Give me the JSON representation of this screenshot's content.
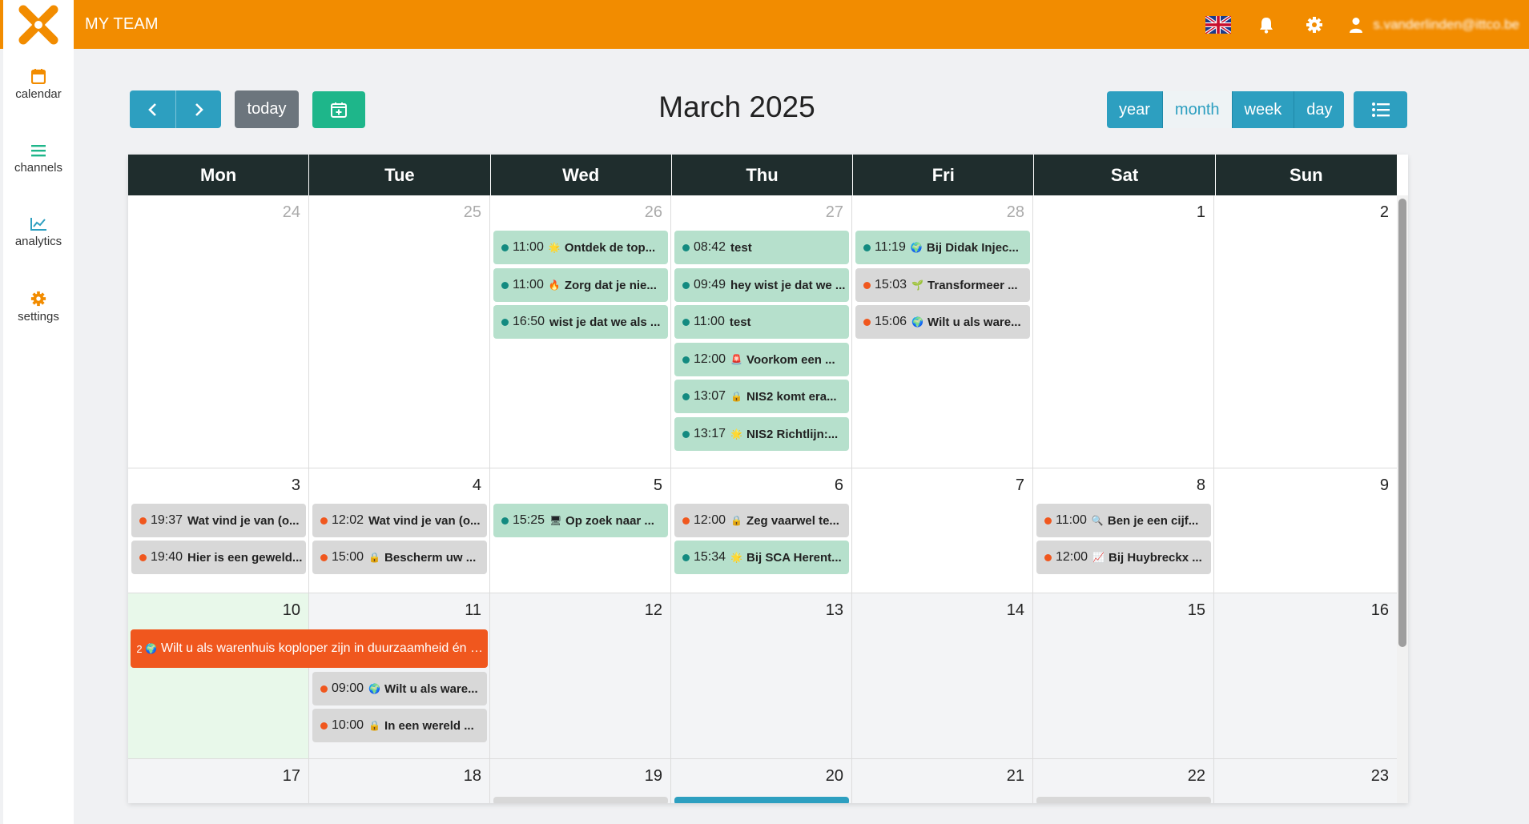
{
  "app": {
    "title": "MY TEAM",
    "user_email": "s.vanderlinden@ittco.be"
  },
  "sidebar": {
    "items": [
      {
        "label": "calendar",
        "icon": "calendar-icon",
        "color": "#f28c00"
      },
      {
        "label": "channels",
        "icon": "menu-icon",
        "color": "#1eb68a"
      },
      {
        "label": "analytics",
        "icon": "chart-line-icon",
        "color": "#2d9fc0"
      },
      {
        "label": "settings",
        "icon": "gear-icon",
        "color": "#f28c00"
      }
    ]
  },
  "toolbar": {
    "today_label": "today",
    "title": "March 2025",
    "views": [
      "year",
      "month",
      "week",
      "day"
    ],
    "active_view": "month"
  },
  "weekdays": [
    "Mon",
    "Tue",
    "Wed",
    "Thu",
    "Fri",
    "Sat",
    "Sun"
  ],
  "weeks": [
    [
      "24",
      "25",
      "26",
      "27",
      "28",
      "1",
      "2"
    ],
    [
      "3",
      "4",
      "5",
      "6",
      "7",
      "8",
      "9"
    ],
    [
      "10",
      "11",
      "12",
      "13",
      "14",
      "15",
      "16"
    ],
    [
      "17",
      "18",
      "19",
      "20",
      "21",
      "22",
      "23"
    ]
  ],
  "events": {
    "w1_wed": [
      {
        "time": "11:00",
        "emoji": "🌟",
        "title": "Ontdek de top..."
      },
      {
        "time": "11:00",
        "emoji": "🔥",
        "title": "Zorg dat je nie..."
      },
      {
        "time": "16:50",
        "emoji": "",
        "title": "wist je dat we als ..."
      }
    ],
    "w1_thu": [
      {
        "time": "08:42",
        "emoji": "",
        "title": "test"
      },
      {
        "time": "09:49",
        "emoji": "",
        "title": "hey wist je dat we ..."
      },
      {
        "time": "11:00",
        "emoji": "",
        "title": "test"
      },
      {
        "time": "12:00",
        "emoji": "🚨",
        "title": "Voorkom een ..."
      },
      {
        "time": "13:07",
        "emoji": "🔒",
        "title": "NIS2 komt era..."
      },
      {
        "time": "13:17",
        "emoji": "🌟",
        "title": "NIS2 Richtlijn:..."
      }
    ],
    "w1_fri": [
      {
        "time": "11:19",
        "emoji": "🌍",
        "title": "Bij Didak Injec..."
      },
      {
        "time": "15:03",
        "emoji": "🌱",
        "title": "Transformeer ..."
      },
      {
        "time": "15:06",
        "emoji": "🌍",
        "title": "Wilt u als ware..."
      }
    ],
    "w2_mon": [
      {
        "time": "19:37",
        "emoji": "",
        "title": "Wat vind je van (o..."
      },
      {
        "time": "19:40",
        "emoji": "",
        "title": "Hier is een geweld..."
      }
    ],
    "w2_tue": [
      {
        "time": "12:02",
        "emoji": "",
        "title": "Wat vind je van (o..."
      },
      {
        "time": "15:00",
        "emoji": "🔒",
        "title": "Bescherm uw ..."
      }
    ],
    "w2_wed": [
      {
        "time": "15:25",
        "emoji": "🖥",
        "title": "Op zoek naar ..."
      }
    ],
    "w2_thu": [
      {
        "time": "12:00",
        "emoji": "🔒",
        "title": "Zeg vaarwel te..."
      },
      {
        "time": "15:34",
        "emoji": "🌟",
        "title": "Bij SCA Herent..."
      }
    ],
    "w2_sat": [
      {
        "time": "11:00",
        "emoji": "🔍",
        "title": "Ben je een cijf..."
      },
      {
        "time": "12:00",
        "emoji": "📈",
        "title": "Bij Huybreckx ..."
      }
    ],
    "w3_banner": {
      "prefix": "2",
      "emoji": "🌍",
      "title": "Wilt u als warenhuis koploper zijn in duurzaamheid én u..."
    },
    "w3_tue": [
      {
        "time": "09:00",
        "emoji": "🌍",
        "title": "Wilt u als ware..."
      },
      {
        "time": "10:00",
        "emoji": "🔒",
        "title": "In een wereld ..."
      }
    ]
  }
}
